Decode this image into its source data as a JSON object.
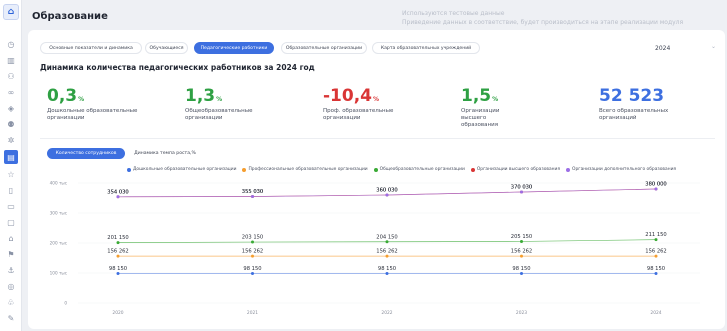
{
  "header": {
    "title": "Образование",
    "notice_line1": "Используются тестовые данные",
    "notice_line2": "Приведение данных в соответствие, будет производиться на этапе реализации модуля"
  },
  "tabs": [
    {
      "label": "Основные показатели и динамика",
      "active": false
    },
    {
      "label": "Обучающиеся",
      "active": false
    },
    {
      "label": "Педагогические работники",
      "active": true
    },
    {
      "label": "Образовательные организации",
      "active": false
    },
    {
      "label": "Карта образовательных учреждений",
      "active": false
    }
  ],
  "year_select": {
    "value": "2024"
  },
  "section_title": "Динамика количества педагогических работников за 2024 год",
  "kpis": [
    {
      "value": "0,3",
      "unit": "%",
      "label": "Дошкольные образовательные организации",
      "color": "#2ea043"
    },
    {
      "value": "1,3",
      "unit": "%",
      "label": "Общеобразовательные организации",
      "color": "#2ea043"
    },
    {
      "value": "-10,4",
      "unit": "%",
      "label": "Проф. образовательные организации",
      "color": "#d93535"
    },
    {
      "value": "1,5",
      "unit": "%",
      "label": "Организации высшего образования",
      "color": "#2ea043"
    },
    {
      "value": "52 523",
      "unit": "",
      "label": "Всего образовательных организаций",
      "color": "#3d6fe0"
    }
  ],
  "chart_tabs": [
    {
      "label": "Количество сотрудников",
      "active": true
    },
    {
      "label": "Динамика темпа роста,%",
      "active": false
    }
  ],
  "chart_data": {
    "type": "line",
    "x": [
      "2020",
      "2021",
      "2022",
      "2023",
      "2024"
    ],
    "ylim": [
      0,
      400000
    ],
    "y_ticks": [
      {
        "value": 0,
        "label": "0"
      },
      {
        "value": 100000,
        "label": "100 тыс"
      },
      {
        "value": 200000,
        "label": "200 тыс"
      },
      {
        "value": 300000,
        "label": "300 тыс"
      },
      {
        "value": 400000,
        "label": "400 тыс"
      }
    ],
    "series": [
      {
        "name": "Дошкольные образовательные организации",
        "color": "#3d6fe0",
        "values": [
          98150,
          98150,
          98150,
          98150,
          98150
        ],
        "labels": [
          "98 150",
          "98 150",
          "98 150",
          "98 150",
          "98 150"
        ]
      },
      {
        "name": "Профессиональные образовательные организации",
        "color": "#f59e2f",
        "values": [
          156262,
          156262,
          156262,
          156262,
          156262
        ],
        "labels": [
          "156 262",
          "156 262",
          "156 262",
          "156 262",
          "156 262"
        ]
      },
      {
        "name": "Общеобразовательные организации",
        "color": "#3aaa35",
        "values": [
          201150,
          203150,
          204150,
          205150,
          211150
        ],
        "labels": [
          "201 150",
          "203 150",
          "204 150",
          "205 150",
          "211 150"
        ]
      },
      {
        "name": "Организации высшего образования",
        "color": "#d93535",
        "values": [
          354030,
          355030,
          360030,
          370030,
          380000
        ],
        "labels": [
          "354 030",
          "355 030",
          "360 030",
          "370 030",
          "380 000"
        ]
      },
      {
        "name": "Организации дополнительного образования",
        "color": "#9b6ee6",
        "values": [
          354030,
          355030,
          360030,
          370030,
          380000
        ],
        "labels": [
          "354 030",
          "355 030",
          "360 030",
          "370 030",
          "380 000"
        ]
      }
    ]
  }
}
